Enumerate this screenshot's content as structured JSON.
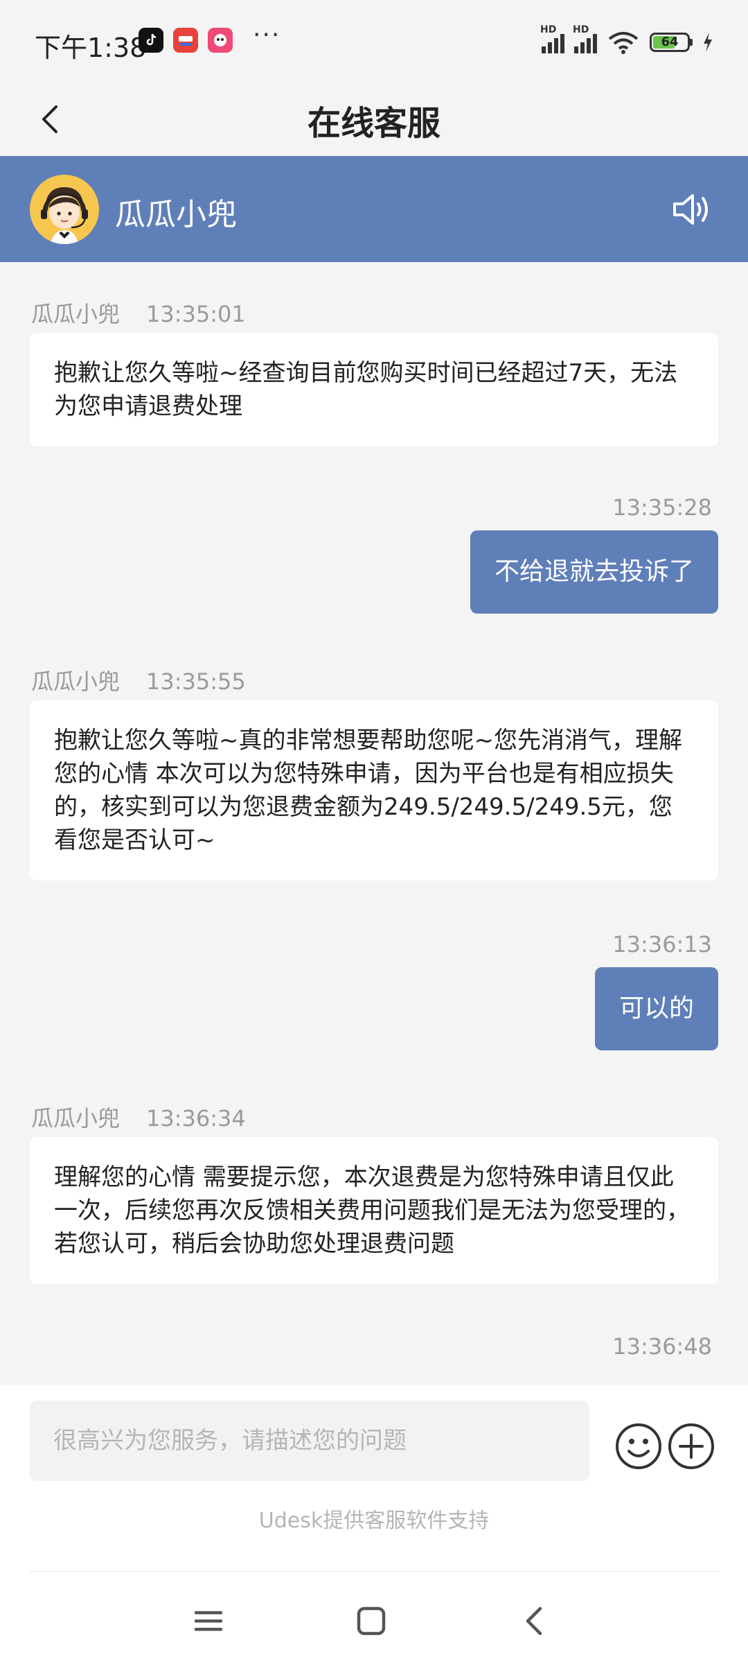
{
  "status_bar": {
    "time": "下午1:38",
    "more": "···",
    "battery_level": "64",
    "battery_fraction": 0.64
  },
  "nav": {
    "title": "在线客服"
  },
  "agent": {
    "name": "瓜瓜小兜"
  },
  "messages": [
    {
      "side": "in",
      "sender": "瓜瓜小兜",
      "time": "13:35:01",
      "text": "抱歉让您久等啦~经查询目前您购买时间已经超过7天，无法为您申请退费处理"
    },
    {
      "side": "out",
      "time": "13:35:28",
      "text": "不给退就去投诉了"
    },
    {
      "side": "in",
      "sender": "瓜瓜小兜",
      "time": "13:35:55",
      "text": "抱歉让您久等啦~真的非常想要帮助您呢~您先消消气，理解您的心情 本次可以为您特殊申请，因为平台也是有相应损失的，核实到可以为您退费金额为249.5/249.5/249.5元，您看您是否认可~"
    },
    {
      "side": "out",
      "time": "13:36:13",
      "text": "可以的"
    },
    {
      "side": "in",
      "sender": "瓜瓜小兜",
      "time": "13:36:34",
      "text": "理解您的心情 需要提示您，本次退费是为您特殊申请且仅此一次，后续您再次反馈相关费用问题我们是无法为您受理的，若您认可，稍后会协助您处理退费问题"
    },
    {
      "side": "out",
      "time": "13:36:48",
      "text": ""
    }
  ],
  "input": {
    "placeholder": "很高兴为您服务，请描述您的问题"
  },
  "footer": {
    "powered_by": "Udesk提供客服软件支持"
  },
  "icons": {
    "back": "chevron-left-icon",
    "speaker": "speaker-icon",
    "emoji": "smiley-icon",
    "add": "plus-circle-icon",
    "menu": "menu-icon",
    "home": "home-square-icon",
    "sys_back": "system-back-icon"
  },
  "colors": {
    "accent": "#5f7fb9",
    "background": "#f4f4f4",
    "bubble_in": "#ffffff",
    "meta_text": "#9a9a9a"
  }
}
